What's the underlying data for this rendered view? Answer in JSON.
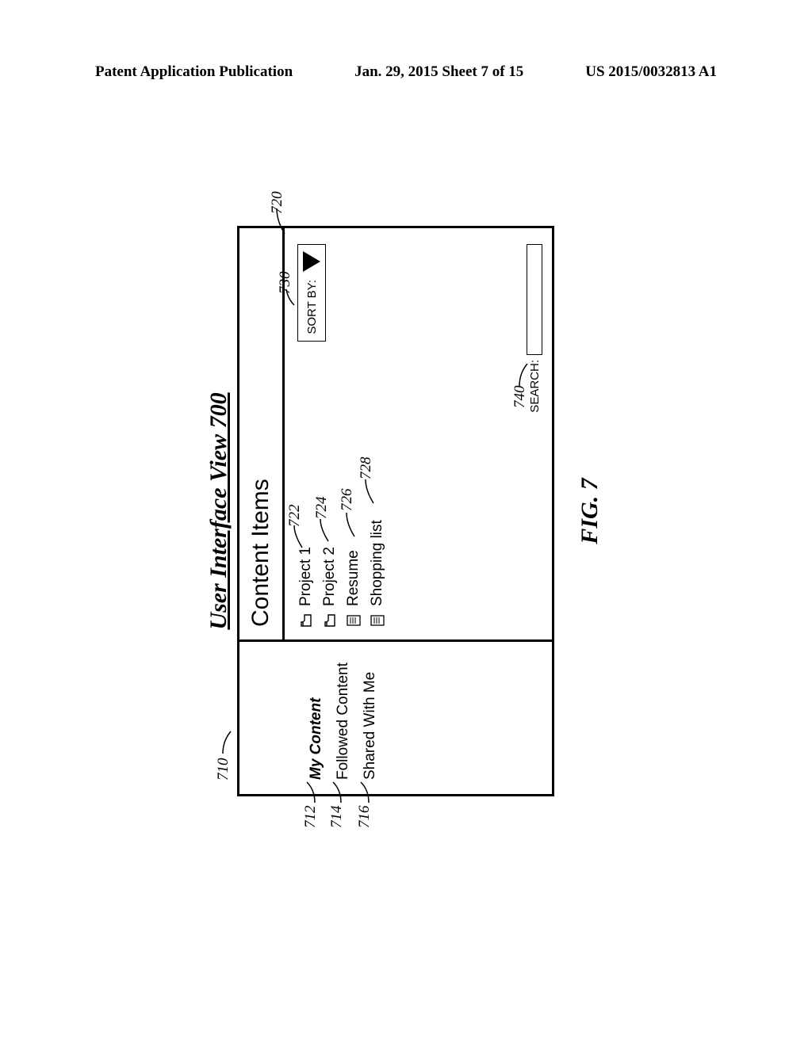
{
  "header": {
    "left": "Patent Application Publication",
    "center": "Jan. 29, 2015  Sheet 7 of 15",
    "right": "US 2015/0032813 A1"
  },
  "figure": {
    "title": "User Interface View 700",
    "label": "FIG. 7"
  },
  "nav": {
    "items": [
      {
        "label": "My Content",
        "active": true
      },
      {
        "label": "Followed Content",
        "active": false
      },
      {
        "label": "Shared With Me",
        "active": false
      }
    ]
  },
  "content": {
    "header": "Content Items",
    "items": [
      {
        "label": "Project 1",
        "icon": "folder"
      },
      {
        "label": "Project 2",
        "icon": "folder"
      },
      {
        "label": "Resume",
        "icon": "doc"
      },
      {
        "label": "Shopping list",
        "icon": "doc"
      }
    ]
  },
  "sort": {
    "label": "SORT BY:"
  },
  "search": {
    "label": "SEARCH:"
  },
  "refs": {
    "r710": "710",
    "r712": "712",
    "r714": "714",
    "r716": "716",
    "r720": "720",
    "r722": "722",
    "r724": "724",
    "r726": "726",
    "r728": "728",
    "r730": "730",
    "r740": "740"
  }
}
